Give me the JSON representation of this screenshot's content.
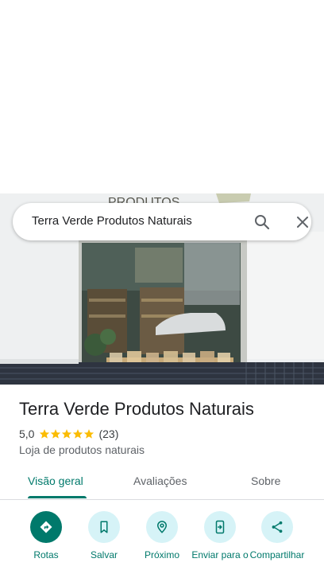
{
  "search": {
    "query": "Terra Verde Produtos Naturais"
  },
  "place": {
    "name": "Terra Verde Produtos Naturais",
    "rating": "5,0",
    "stars": 5,
    "review_count": "(23)",
    "category": "Loja de produtos naturais"
  },
  "tabs": [
    {
      "label": "Visão geral",
      "active": true
    },
    {
      "label": "Avaliações",
      "active": false
    },
    {
      "label": "Sobre",
      "active": false
    }
  ],
  "actions": [
    {
      "label": "Rotas",
      "icon": "directions-icon"
    },
    {
      "label": "Salvar",
      "icon": "bookmark-icon"
    },
    {
      "label": "Próximo",
      "icon": "nearby-icon"
    },
    {
      "label": "Enviar para o",
      "icon": "send-to-phone-icon"
    },
    {
      "label": "Compartilhar",
      "icon": "share-icon"
    }
  ],
  "photo": {
    "sign_text": "PRODUTOS"
  },
  "colors": {
    "accent": "#00796b",
    "action_bg": "#d6f3f7",
    "star": "#fbbc04"
  }
}
